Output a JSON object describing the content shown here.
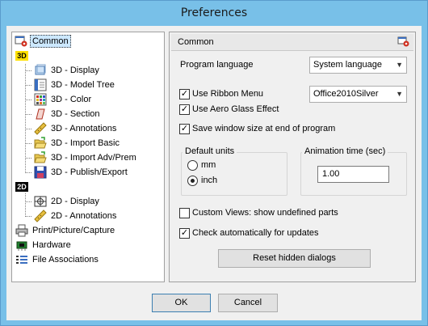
{
  "window": {
    "title": "Preferences"
  },
  "tree": {
    "common": "Common",
    "group_3d": "3D",
    "items_3d": [
      {
        "label": "3D - Display",
        "icon": "display-icon"
      },
      {
        "label": "3D - Model Tree",
        "icon": "model-tree-icon"
      },
      {
        "label": "3D - Color",
        "icon": "color-icon"
      },
      {
        "label": "3D - Section",
        "icon": "section-icon"
      },
      {
        "label": "3D - Annotations",
        "icon": "ruler-icon"
      },
      {
        "label": "3D - Import Basic",
        "icon": "folder-open-icon"
      },
      {
        "label": "3D - Import Adv/Prem",
        "icon": "folder-open-icon"
      },
      {
        "label": "3D - Publish/Export",
        "icon": "save-icon"
      }
    ],
    "group_2d": "2D",
    "items_2d": [
      {
        "label": "2D - Display",
        "icon": "display-2d-icon"
      },
      {
        "label": "2D - Annotations",
        "icon": "ruler-icon"
      }
    ],
    "print": "Print/Picture/Capture",
    "hardware": "Hardware",
    "file_assoc": "File Associations"
  },
  "panel": {
    "header": "Common",
    "program_language_label": "Program language",
    "program_language_value": "System language",
    "use_ribbon_label": "Use Ribbon Menu",
    "use_ribbon_checked": true,
    "ribbon_style_value": "Office2010Silver",
    "aero_label": "Use Aero Glass Effect",
    "aero_checked": true,
    "save_window_label": "Save window size at end of program",
    "save_window_checked": true,
    "default_units_title": "Default units",
    "unit_mm": "mm",
    "unit_inch": "inch",
    "selected_unit": "inch",
    "animation_title": "Animation time (sec)",
    "animation_value": "1.00",
    "custom_views_label": "Custom Views: show undefined parts",
    "custom_views_checked": false,
    "check_updates_label": "Check automatically for updates",
    "check_updates_checked": true,
    "reset_button": "Reset hidden dialogs"
  },
  "buttons": {
    "ok": "OK",
    "cancel": "Cancel"
  }
}
